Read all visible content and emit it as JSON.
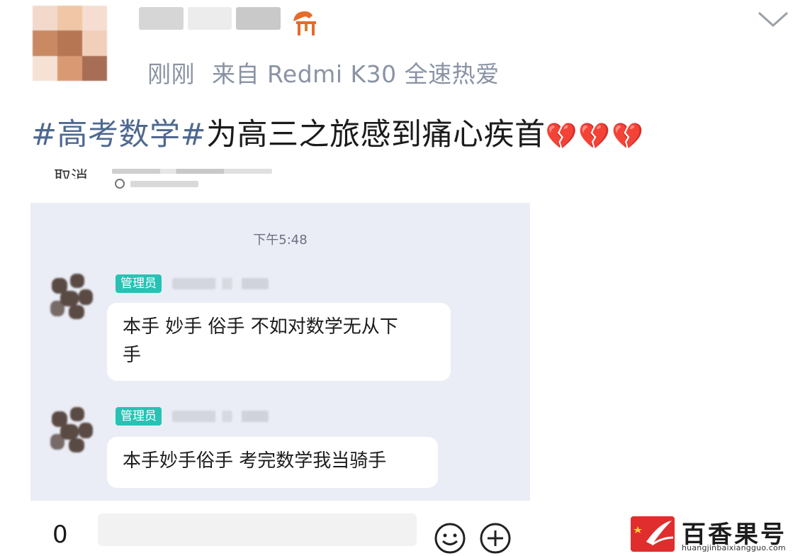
{
  "post": {
    "meta": {
      "time": "刚刚",
      "source": "来自 Redmi K30 全速热爱"
    },
    "text": {
      "tag": "#高考数学#",
      "body": "为高三之旅感到痛心疾首",
      "emojis": "💔💔💔"
    }
  },
  "screenshot": {
    "top_label": "取消",
    "chat_time": "下午5:48",
    "messages": [
      {
        "badge": "管理员",
        "lines": [
          "本手 妙手 俗手 不如对数学无从下",
          "手"
        ]
      },
      {
        "badge": "管理员",
        "lines": [
          "本手妙手俗手 考完数学我当骑手"
        ]
      }
    ]
  },
  "bottom_bar": {
    "count": "0",
    "extra": ""
  },
  "watermark": {
    "title": "百香果号",
    "url": "huangjinbaixiangguo.com"
  },
  "icons": {
    "vip": "vip-icon",
    "collapse": "chevron-down-icon",
    "emoji": "smile-icon",
    "add": "plus-icon",
    "logo": "brand-logo-icon"
  },
  "colors": {
    "tag": "#4e6890",
    "meta": "#8a93a4",
    "chat_bg": "#eaedf5",
    "badge": "#27c2b4",
    "watermark_red": "#e02d2d"
  }
}
